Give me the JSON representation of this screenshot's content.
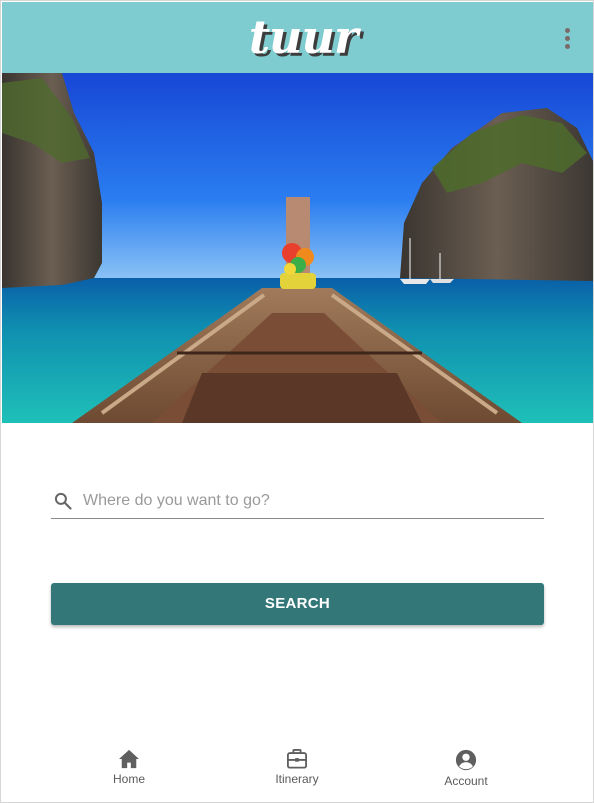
{
  "header": {
    "logo_text": "tuur",
    "menu_icon": "more-vertical-icon",
    "background_color": "#7ecbd0"
  },
  "hero": {
    "image": "tropical-longtail-boat-bow-between-limestone-cliffs"
  },
  "search": {
    "icon": "search-icon",
    "placeholder": "Where do you want to go?",
    "value": "",
    "button_label": "SEARCH",
    "button_color": "#347779"
  },
  "bottom_nav": {
    "items": [
      {
        "label": "Home",
        "icon": "home-icon"
      },
      {
        "label": "Itinerary",
        "icon": "briefcase-icon"
      },
      {
        "label": "Account",
        "icon": "account-circle-icon"
      }
    ]
  }
}
